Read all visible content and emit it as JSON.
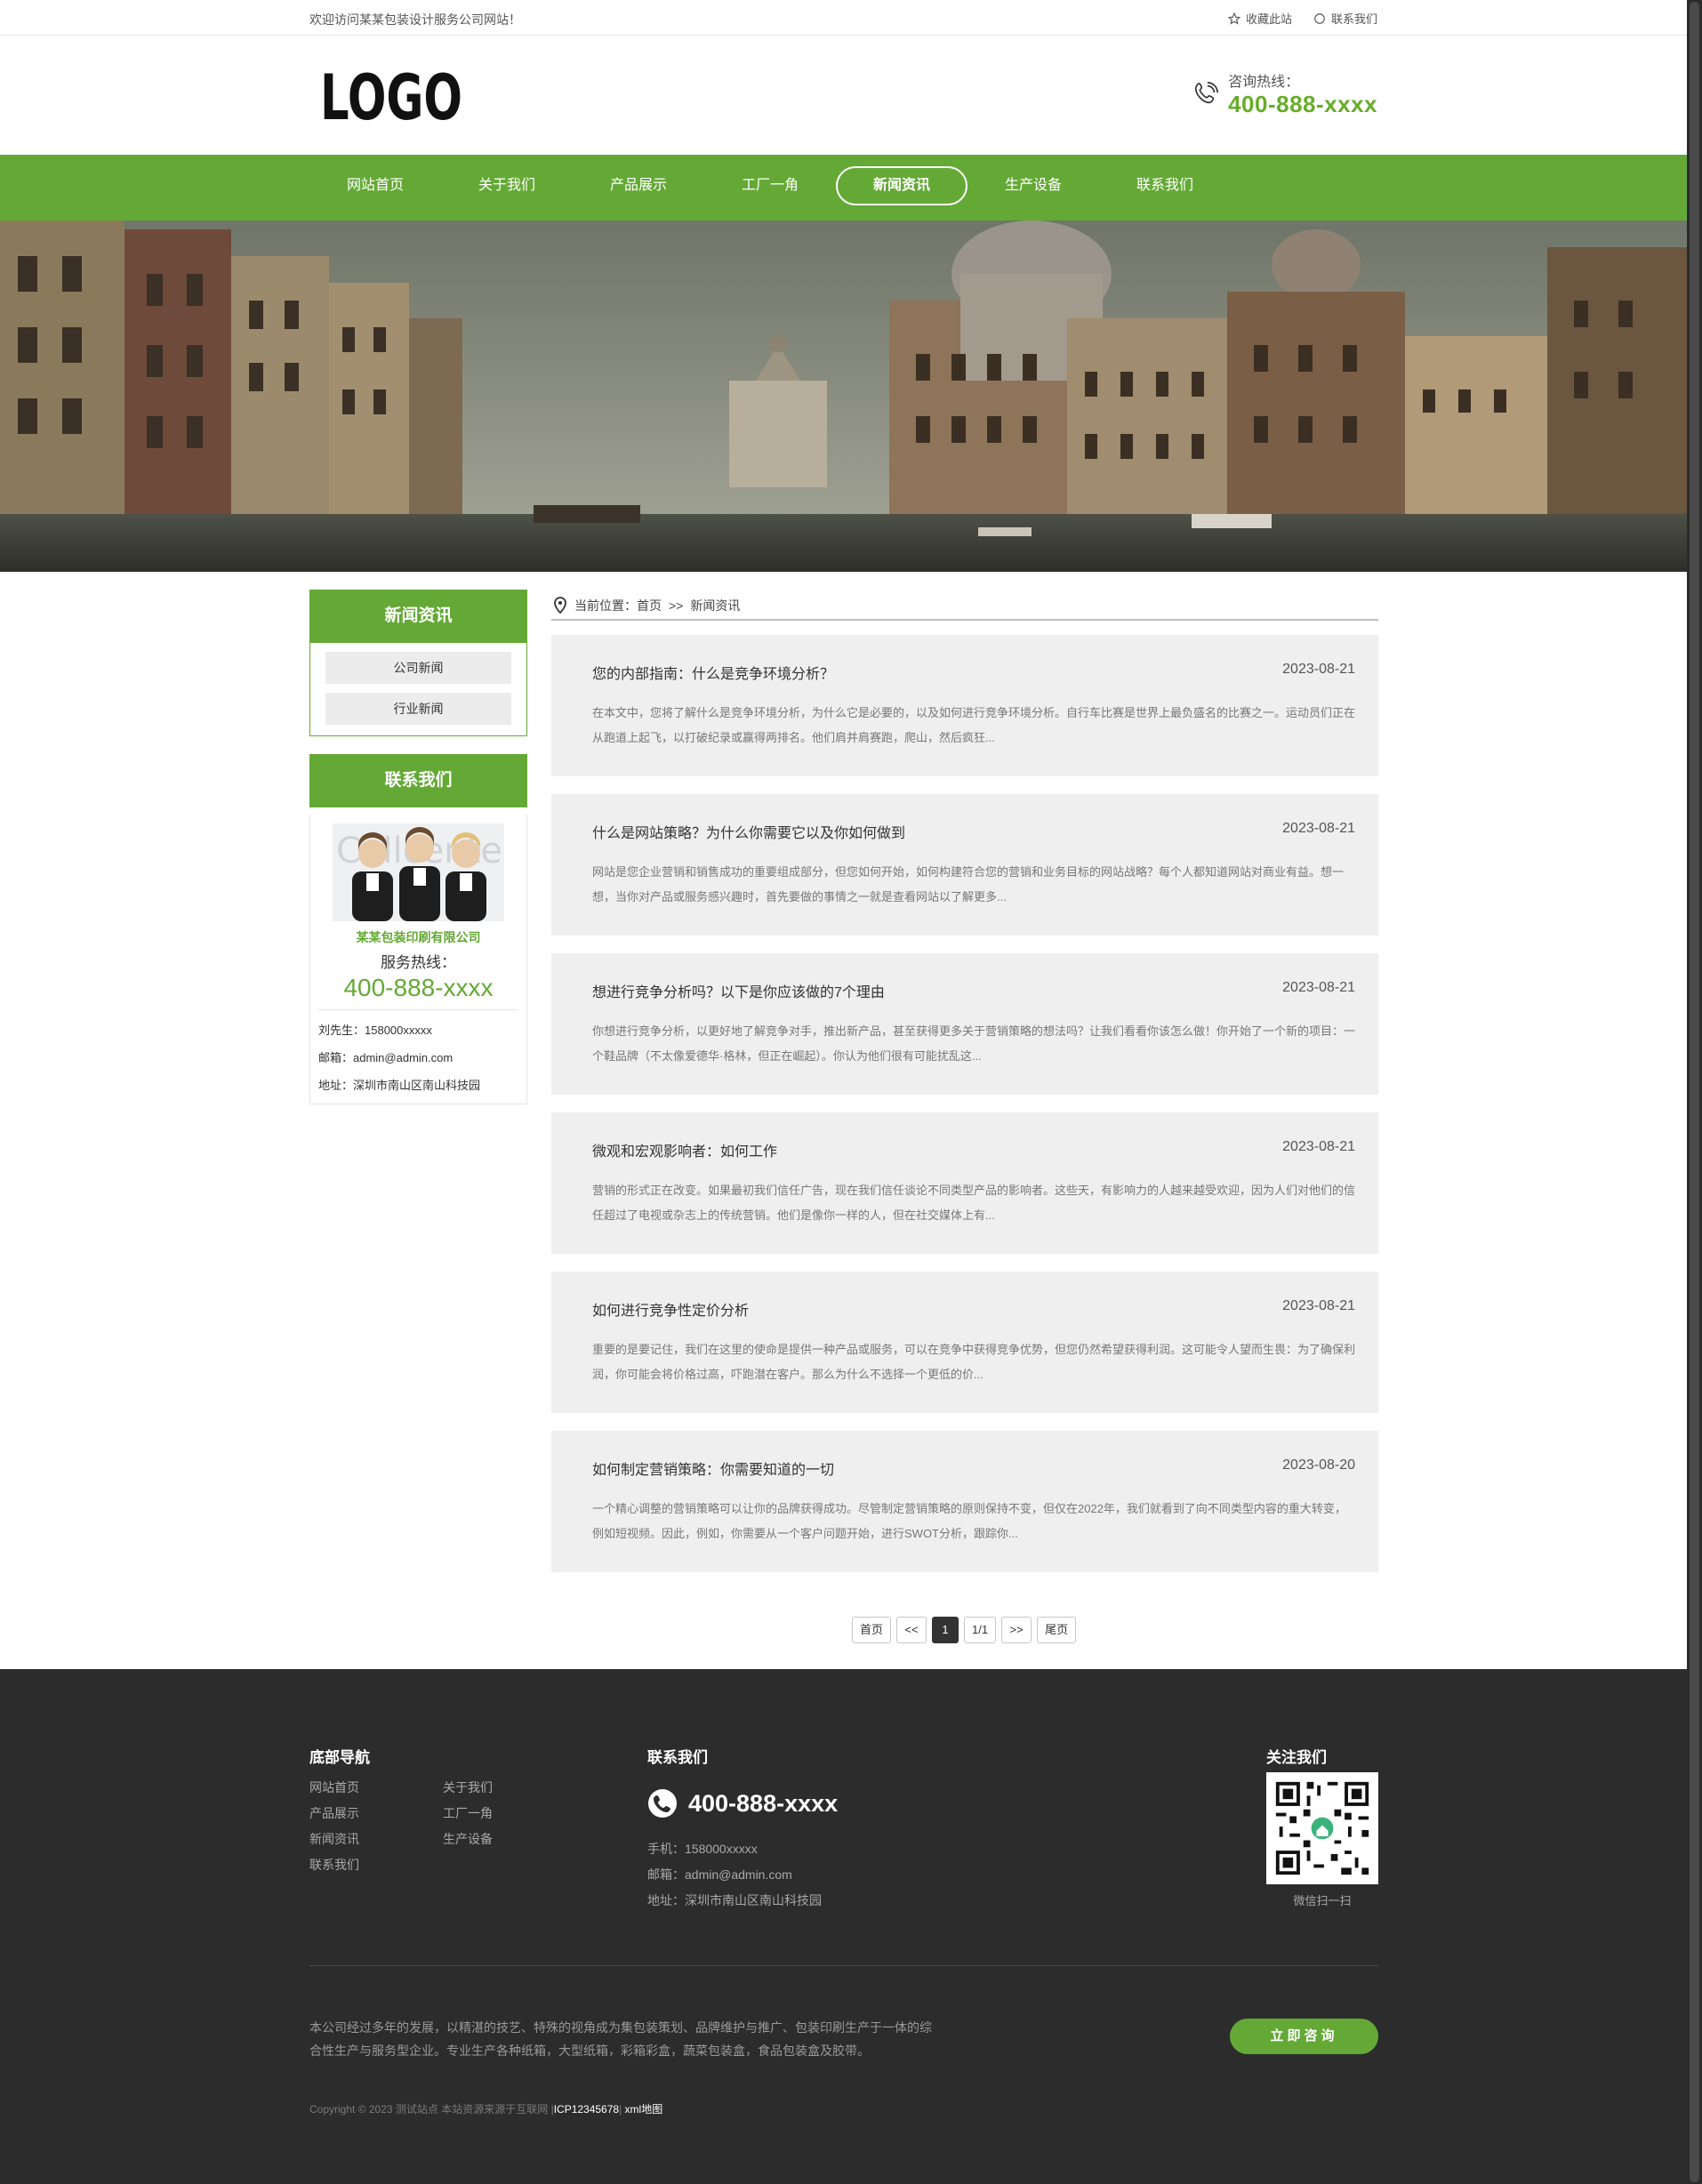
{
  "topbar": {
    "welcome": "欢迎访问某某包装设计服务公司网站！",
    "favorite": "收藏此站",
    "contact": "联系我们"
  },
  "header": {
    "logo_text": "LOGO",
    "hotline_label": "咨询热线：",
    "hotline_number": "400-888-xxxx"
  },
  "nav": {
    "items": [
      {
        "label": "网站首页"
      },
      {
        "label": "关于我们"
      },
      {
        "label": "产品展示"
      },
      {
        "label": "工厂一角"
      },
      {
        "label": "新闻资讯",
        "active": true
      },
      {
        "label": "生产设备"
      },
      {
        "label": "联系我们"
      }
    ]
  },
  "sidebar": {
    "category_title": "新闻资讯",
    "categories": [
      "公司新闻",
      "行业新闻"
    ],
    "contact_title": "联系我们",
    "company": "某某包装印刷有限公司",
    "service_label": "服务热线：",
    "service_number": "400-888-xxxx",
    "contact_person": "刘先生：158000xxxxx",
    "email": "邮箱：admin@admin.com",
    "address": "地址：深圳市南山区南山科技园"
  },
  "breadcrumb": {
    "label": "当前位置：",
    "home": "首页",
    "sep": ">>",
    "current": "新闻资讯"
  },
  "news": [
    {
      "title": "您的内部指南：什么是竞争环境分析？",
      "date": "2023-08-21",
      "desc": "在本文中，您将了解什么是竞争环境分析，为什么它是必要的，以及如何进行竞争环境分析。自行车比赛是世界上最负盛名的比赛之一。运动员们正在从跑道上起飞，以打破纪录或赢得两排名。他们肩并肩赛跑，爬山，然后疯狂..."
    },
    {
      "title": "什么是网站策略？为什么你需要它以及你如何做到",
      "date": "2023-08-21",
      "desc": "网站是您企业营销和销售成功的重要组成部分，但您如何开始，如何构建符合您的营销和业务目标的网站战略？每个人都知道网站对商业有益。想一想，当你对产品或服务感兴趣时，首先要做的事情之一就是查看网站以了解更多..."
    },
    {
      "title": "想进行竞争分析吗？以下是你应该做的7个理由",
      "date": "2023-08-21",
      "desc": "你想进行竞争分析，以更好地了解竞争对手，推出新产品，甚至获得更多关于营销策略的想法吗？让我们看看你该怎么做！你开始了一个新的项目：一个鞋品牌（不太像爱德华·格林，但正在崛起）。你认为他们很有可能扰乱这..."
    },
    {
      "title": "微观和宏观影响者：如何工作",
      "date": "2023-08-21",
      "desc": "营销的形式正在改变。如果最初我们信任广告，现在我们信任谈论不同类型产品的影响者。这些天，有影响力的人越来越受欢迎，因为人们对他们的信任超过了电视或杂志上的传统营销。他们是像你一样的人，但在社交媒体上有..."
    },
    {
      "title": "如何进行竞争性定价分析",
      "date": "2023-08-21",
      "desc": "重要的是要记住，我们在这里的使命是提供一种产品或服务，可以在竞争中获得竞争优势，但您仍然希望获得利润。这可能令人望而生畏：为了确保利润，你可能会将价格过高，吓跑潜在客户。那么为什么不选择一个更低的价..."
    },
    {
      "title": "如何制定营销策略：你需要知道的一切",
      "date": "2023-08-20",
      "desc": "一个精心调整的营销策略可以让你的品牌获得成功。尽管制定营销策略的原则保持不变，但仅在2022年，我们就看到了向不同类型内容的重大转变，例如短视频。因此，例如，你需要从一个客户问题开始，进行SWOT分析，跟踪你..."
    }
  ],
  "pagination": {
    "first": "首页",
    "prev": "<<",
    "current": "1",
    "total": "1/1",
    "next": ">>",
    "last": "尾页"
  },
  "footer": {
    "nav_title": "底部导航",
    "nav_links": [
      "网站首页",
      "关于我们",
      "产品展示",
      "工厂一角",
      "新闻资讯",
      "生产设备",
      "联系我们"
    ],
    "contact_title": "联系我们",
    "phone": "400-888-xxxx",
    "mobile": "手机：158000xxxxx",
    "email": "邮箱：admin@admin.com",
    "address": "地址：深圳市南山区南山科技园",
    "follow_title": "关注我们",
    "qr_label": "微信扫一扫",
    "intro": "本公司经过多年的发展，以精湛的技艺、特殊的视角成为集包装策划、品牌维护与推广、包装印刷生产于一体的综合性生产与服务型企业。专业生产各种纸箱，大型纸箱，彩箱彩盒，蔬菜包装盒，食品包装盒及胶带。",
    "consult": "立即咨询",
    "copyright": "Copyright © 2023 测试站点 本站资源来源于互联网",
    "icp": "ICP12345678",
    "sitemap": "xml地图"
  },
  "colors": {
    "brand_green": "#64a935",
    "footer_bg": "#2c2c2c"
  }
}
